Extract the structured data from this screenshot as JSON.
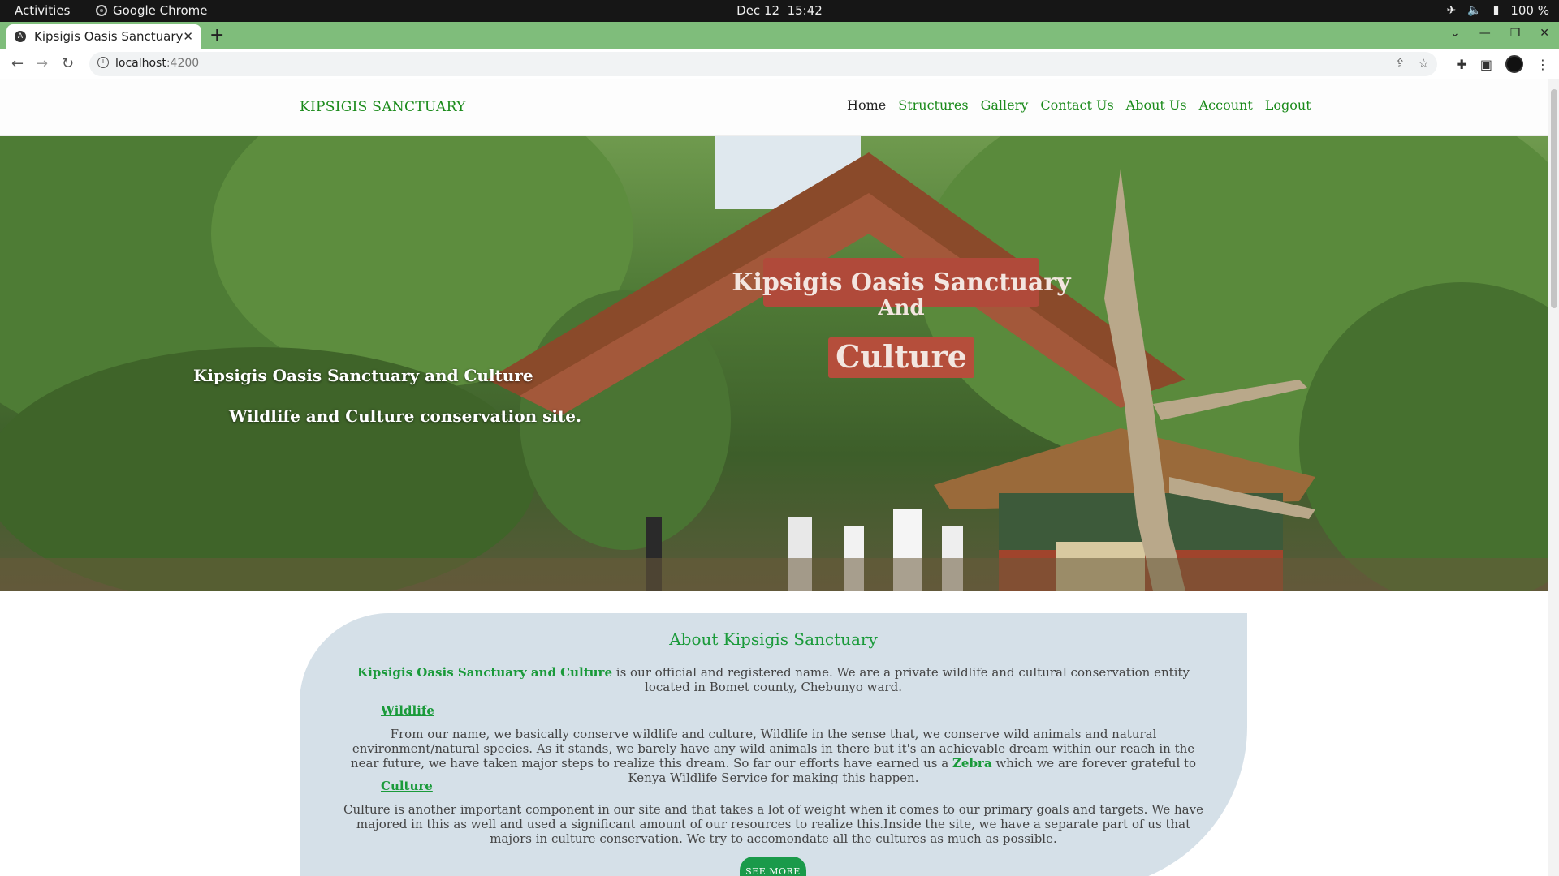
{
  "os_bar": {
    "activities": "Activities",
    "app_name": "Google Chrome",
    "date": "Dec 12",
    "time": "15:42",
    "battery": "100 %"
  },
  "browser": {
    "tab_title": "Kipsigis Oasis Sanctuary",
    "tab_close": "✕",
    "new_tab": "+",
    "url_host": "localhost",
    "url_port": ":4200"
  },
  "site": {
    "brand": "KIPSIGIS SANCTUARY",
    "nav": {
      "home": "Home",
      "structures": "Structures",
      "gallery": "Gallery",
      "contact": "Contact Us",
      "about": "About Us",
      "account": "Account",
      "logout": "Logout"
    },
    "hero": {
      "line1": "Kipsigis Oasis Sanctuary and Culture",
      "line2": "Wildlife and Culture conservation site.",
      "sign_top": "Kipsigis Oasis Sanctuary",
      "sign_mid": "And",
      "sign_bottom": "Culture"
    },
    "about": {
      "title": "About Kipsigis Sanctuary",
      "intro_highlight": "Kipsigis Oasis Sanctuary and Culture",
      "intro_rest": " is our official and registered name. We are a private wildlife and cultural conservation entity located in Bomet county, Chebunyo ward.",
      "wildlife_heading": "Wildlife",
      "wildlife_text_a": "From our name, we basically conserve wildlife and culture, Wildlife in the sense that, we conserve wild animals and natural environment/natural species. As it stands, we barely have any wild animals in there but it's an achievable dream within our reach in the near future, we have taken major steps to realize this dream. So far our efforts have earned us a ",
      "wildlife_highlight": "Zebra",
      "wildlife_text_b": " which we are forever grateful to Kenya Wildlife Service for making this happen.",
      "culture_heading": "Culture",
      "culture_text": "Culture is another important component in our site and that takes a lot of weight when it comes to our primary goals and targets. We have majored in this as well and used a significant amount of our resources to realize this.Inside the site, we have a separate part of us that majors in culture conservation. We try to accomondate all the cultures as much as possible.",
      "see_more": "SEE MORE"
    }
  }
}
